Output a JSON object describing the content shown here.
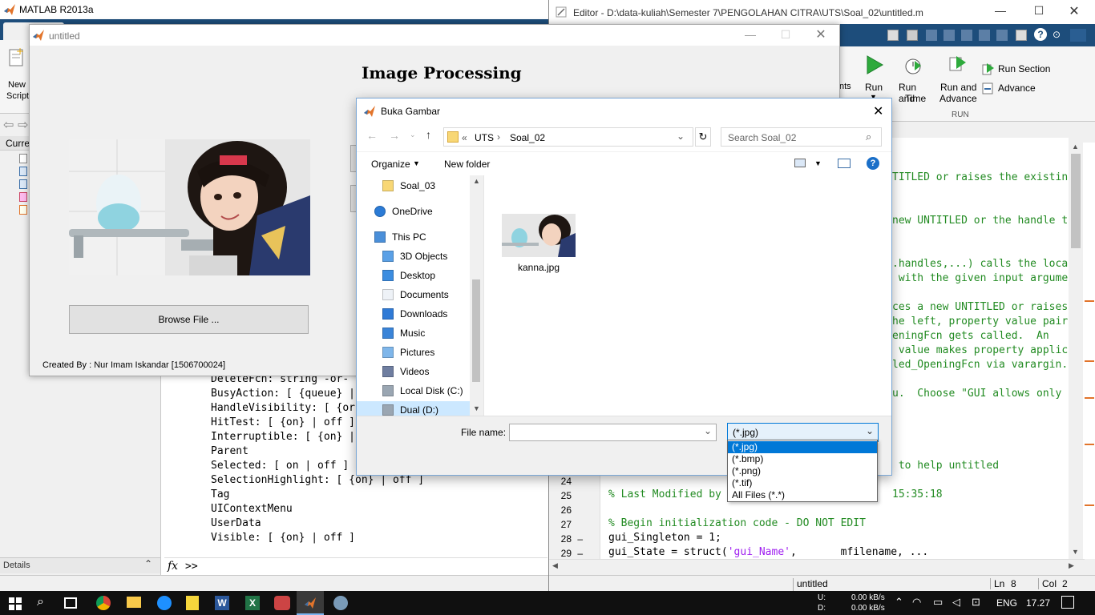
{
  "matlab": {
    "title": "MATLAB R2013a",
    "new_script_label_1": "New",
    "new_script_label_2": "Script",
    "current_folder_tab": "Curre",
    "details_label": "Details",
    "command_prompt": ">>",
    "command_output": [
      "DeleteFcn: string -or-",
      "BusyAction: [ {queue} |",
      "HandleVisibility: [ {or",
      "HitTest: [ {on} | off ]",
      "Interruptible: [ {on} |",
      "Parent",
      "Selected: [ on | off ]",
      "SelectionHighlight: [ {on} | off ]",
      "Tag",
      "UIContextMenu",
      "UserData",
      "Visible: [ {on} | off ]"
    ]
  },
  "editor": {
    "title": "Editor - D:\\data-kuliah\\Semester 7\\PENGOLAHAN CITRA\\UTS\\Soal_02\\untitled.m",
    "toolbar": {
      "run": "Run",
      "run_and_time_1": "Run and",
      "run_and_time_2": "Time",
      "run_and_advance_1": "Run and",
      "run_and_advance_2": "Advance",
      "run_section": "Run Section",
      "advance": "Advance",
      "group_run": "RUN",
      "nts_fragment": "nts"
    },
    "code_fragments": [
      "TITLED or raises the existin",
      "new UNTITLED or the handle t",
      ".handles,...) calls the loca",
      " with the given input argume",
      "ces a new UNTITLED or raises",
      "he left, property value pair",
      "eningFcn gets called.  An",
      " value makes property applic",
      "led_OpeningFcn via varargin.",
      "u.  Choose \"GUI allows only ",
      " to help untitled",
      "15:35:18"
    ],
    "lines": [
      {
        "num": "24",
        "dash": "",
        "code": ""
      },
      {
        "num": "25",
        "dash": "",
        "code": "% Last Modified by"
      },
      {
        "num": "26",
        "dash": "",
        "code": ""
      },
      {
        "num": "27",
        "dash": "",
        "code": "% Begin initialization code - DO NOT EDIT"
      },
      {
        "num": "28",
        "dash": "–",
        "code": "gui_Singleton = 1;"
      },
      {
        "num": "29",
        "dash": "–",
        "code_a": "gui_State = struct(",
        "code_str": "'gui_Name'",
        "code_b": ",       mfilename, ..."
      }
    ],
    "status": {
      "file": "untitled",
      "ln_label": "Ln",
      "ln": "8",
      "col_label": "Col",
      "col": "2"
    }
  },
  "figure": {
    "title": "untitled",
    "heading": "Image Processing",
    "browse_button": "Browse File ...",
    "credit": "Created By : Nur Imam Iskandar [1506700024]"
  },
  "dialog": {
    "title": "Buka Gambar",
    "breadcrumb_chevrons": "«",
    "path": [
      "UTS",
      "Soal_02"
    ],
    "search_placeholder": "Search Soal_02",
    "organize": "Organize",
    "new_folder": "New folder",
    "tree": [
      {
        "label": "Soal_03",
        "icon": "folder-icon",
        "indent": 1
      },
      {
        "label": "OneDrive",
        "icon": "cloud-icon",
        "indent": 0
      },
      {
        "label": "This PC",
        "icon": "computer-icon",
        "indent": 0
      },
      {
        "label": "3D Objects",
        "icon": "cube-icon",
        "indent": 1
      },
      {
        "label": "Desktop",
        "icon": "desktop-icon",
        "indent": 1
      },
      {
        "label": "Documents",
        "icon": "document-icon",
        "indent": 1
      },
      {
        "label": "Downloads",
        "icon": "download-icon",
        "indent": 1
      },
      {
        "label": "Music",
        "icon": "music-icon",
        "indent": 1
      },
      {
        "label": "Pictures",
        "icon": "picture-icon",
        "indent": 1
      },
      {
        "label": "Videos",
        "icon": "video-icon",
        "indent": 1
      },
      {
        "label": "Local Disk (C:)",
        "icon": "drive-icon",
        "indent": 1
      },
      {
        "label": "Dual (D:)",
        "icon": "drive-icon",
        "indent": 1,
        "selected": true
      }
    ],
    "file": "kanna.jpg",
    "file_name_label": "File name:",
    "file_name_value": "",
    "filter_selected": "(*.jpg)",
    "filter_options": [
      "(*.jpg)",
      "(*.bmp)",
      "(*.png)",
      "(*.tif)",
      "All Files (*.*)"
    ]
  },
  "taskbar": {
    "net_up_label": "U:",
    "net_down_label": "D:",
    "net_up": "0.00 kB/s",
    "net_down": "0.00 kB/s",
    "language": "ENG",
    "time": "17.27"
  },
  "colors": {
    "matlab_blue": "#1d4d7b",
    "selection_blue": "#0078d7",
    "comment_green": "#228b22",
    "string_purple": "#a020f0",
    "tree_selected": "#cce8ff"
  }
}
